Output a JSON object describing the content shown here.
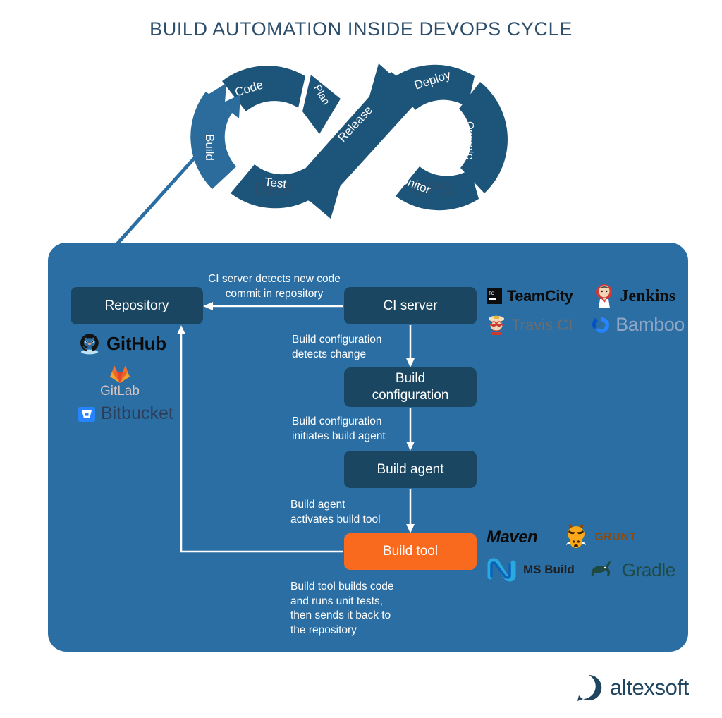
{
  "page": {
    "title": "BUILD AUTOMATION INSIDE DEVOPS CYCLE",
    "title_color": "#2d4f6c",
    "background": "#ffffff"
  },
  "devops_loop": {
    "dev_label": "DEV",
    "ops_label": "OPS",
    "loop_color": "#1d5479",
    "highlight_color": "#2b6c9c",
    "segments": [
      {
        "id": "build",
        "label": "Build",
        "side": "dev",
        "highlighted": true
      },
      {
        "id": "code",
        "label": "Code",
        "side": "dev",
        "highlighted": false
      },
      {
        "id": "plan",
        "label": "Plan",
        "side": "dev",
        "highlighted": false
      },
      {
        "id": "release",
        "label": "Release",
        "side": "center",
        "highlighted": false
      },
      {
        "id": "deploy",
        "label": "Deploy",
        "side": "ops",
        "highlighted": false
      },
      {
        "id": "operate",
        "label": "Operate",
        "side": "ops",
        "highlighted": false
      },
      {
        "id": "monitor",
        "label": "Monitor",
        "side": "ops",
        "highlighted": false
      },
      {
        "id": "test",
        "label": "Test",
        "side": "dev",
        "highlighted": false
      }
    ]
  },
  "panel": {
    "background": "#2a6ea4",
    "node_color": "#1b4661",
    "accent_color": "#fa6a1e"
  },
  "nodes": {
    "repository": "Repository",
    "ci_server": "CI server",
    "build_configuration": "Build\nconfiguration",
    "build_agent": "Build agent",
    "build_tool": "Build tool"
  },
  "flow_labels": {
    "detect_commit": "CI server detects new code\ncommit in repository",
    "config_detects_change": "Build configuration\ndetects change",
    "config_initiates_agent": "Build configuration\ninitiates build agent",
    "agent_activates_tool": "Build agent\nactivates build tool",
    "tool_builds_code": "Build tool builds code\nand runs unit tests,\nthen sends it back to\nthe repository"
  },
  "logos": {
    "repository_tools": [
      {
        "name": "GitHub",
        "icon": "github-icon"
      },
      {
        "name": "GitLab",
        "icon": "gitlab-icon"
      },
      {
        "name": "Bitbucket",
        "icon": "bitbucket-icon"
      }
    ],
    "ci_tools": [
      {
        "name": "TeamCity",
        "icon": "teamcity-icon"
      },
      {
        "name": "Jenkins",
        "icon": "jenkins-icon"
      },
      {
        "name": "Travis CI",
        "icon": "travisci-icon"
      },
      {
        "name": "Bamboo",
        "icon": "bamboo-icon"
      }
    ],
    "build_tools": [
      {
        "name": "Maven",
        "icon": "maven-icon"
      },
      {
        "name": "GRUNT",
        "icon": "grunt-icon"
      },
      {
        "name": "MS Build",
        "icon": "msbuild-icon"
      },
      {
        "name": "Gradle",
        "icon": "gradle-icon"
      }
    ]
  },
  "brand": {
    "name": "altexsoft",
    "color": "#20455f"
  }
}
